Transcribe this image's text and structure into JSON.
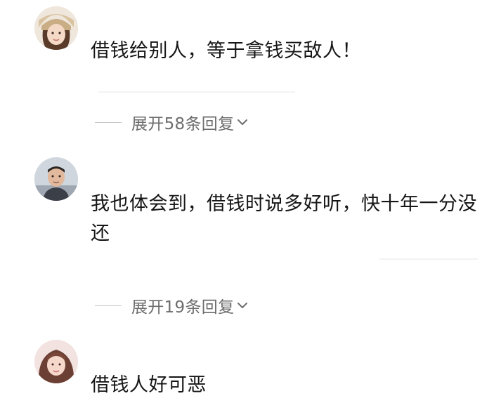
{
  "comments": [
    {
      "text": "借钱给别人，等于拿钱买敌人！",
      "replies_label": "展开58条回复"
    },
    {
      "text": "我也体会到，借钱时说多好听，快十年一分没还",
      "replies_label": "展开19条回复"
    },
    {
      "text": "借钱人好可恶"
    }
  ],
  "icons": {
    "expand": "chevron-down-icon"
  },
  "colors": {
    "text": "#161616",
    "muted": "#6d6d6d",
    "divider": "#c8c8c8"
  }
}
